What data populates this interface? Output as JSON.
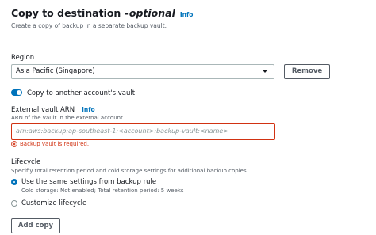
{
  "header": {
    "title": "Copy to destination -",
    "title_optional": "optional",
    "info": "Info",
    "subtitle": "Create a copy of backup in a separate backup vault."
  },
  "region": {
    "label": "Region",
    "selected": "Asia Pacific (Singapore)",
    "remove_label": "Remove"
  },
  "copy_toggle": {
    "label": "Copy to another account's vault",
    "enabled": true
  },
  "external_vault": {
    "label": "External vault ARN",
    "info": "Info",
    "description": "ARN of the vault in the external account.",
    "placeholder": "arn:aws:backup:ap-southeast-1:<account>:backup-vault:<name>",
    "value": "",
    "error": "Backup vault is required."
  },
  "lifecycle": {
    "label": "Lifecycle",
    "description": "Specifiy total retention period and cold storage settings for additional backup copies.",
    "options": [
      {
        "label": "Use the same settings from backup rule",
        "detail": "Cold storage: Not enabled; Total retention period: 5 weeks",
        "selected": true
      },
      {
        "label": "Customize lifecycle",
        "detail": "",
        "selected": false
      }
    ]
  },
  "add_copy_label": "Add copy",
  "colors": {
    "accent": "#0073bb",
    "error": "#d13212",
    "text": "#16191f",
    "muted": "#545b64"
  },
  "icons": {
    "caret": "caret-down-icon",
    "error": "error-circle-icon"
  }
}
